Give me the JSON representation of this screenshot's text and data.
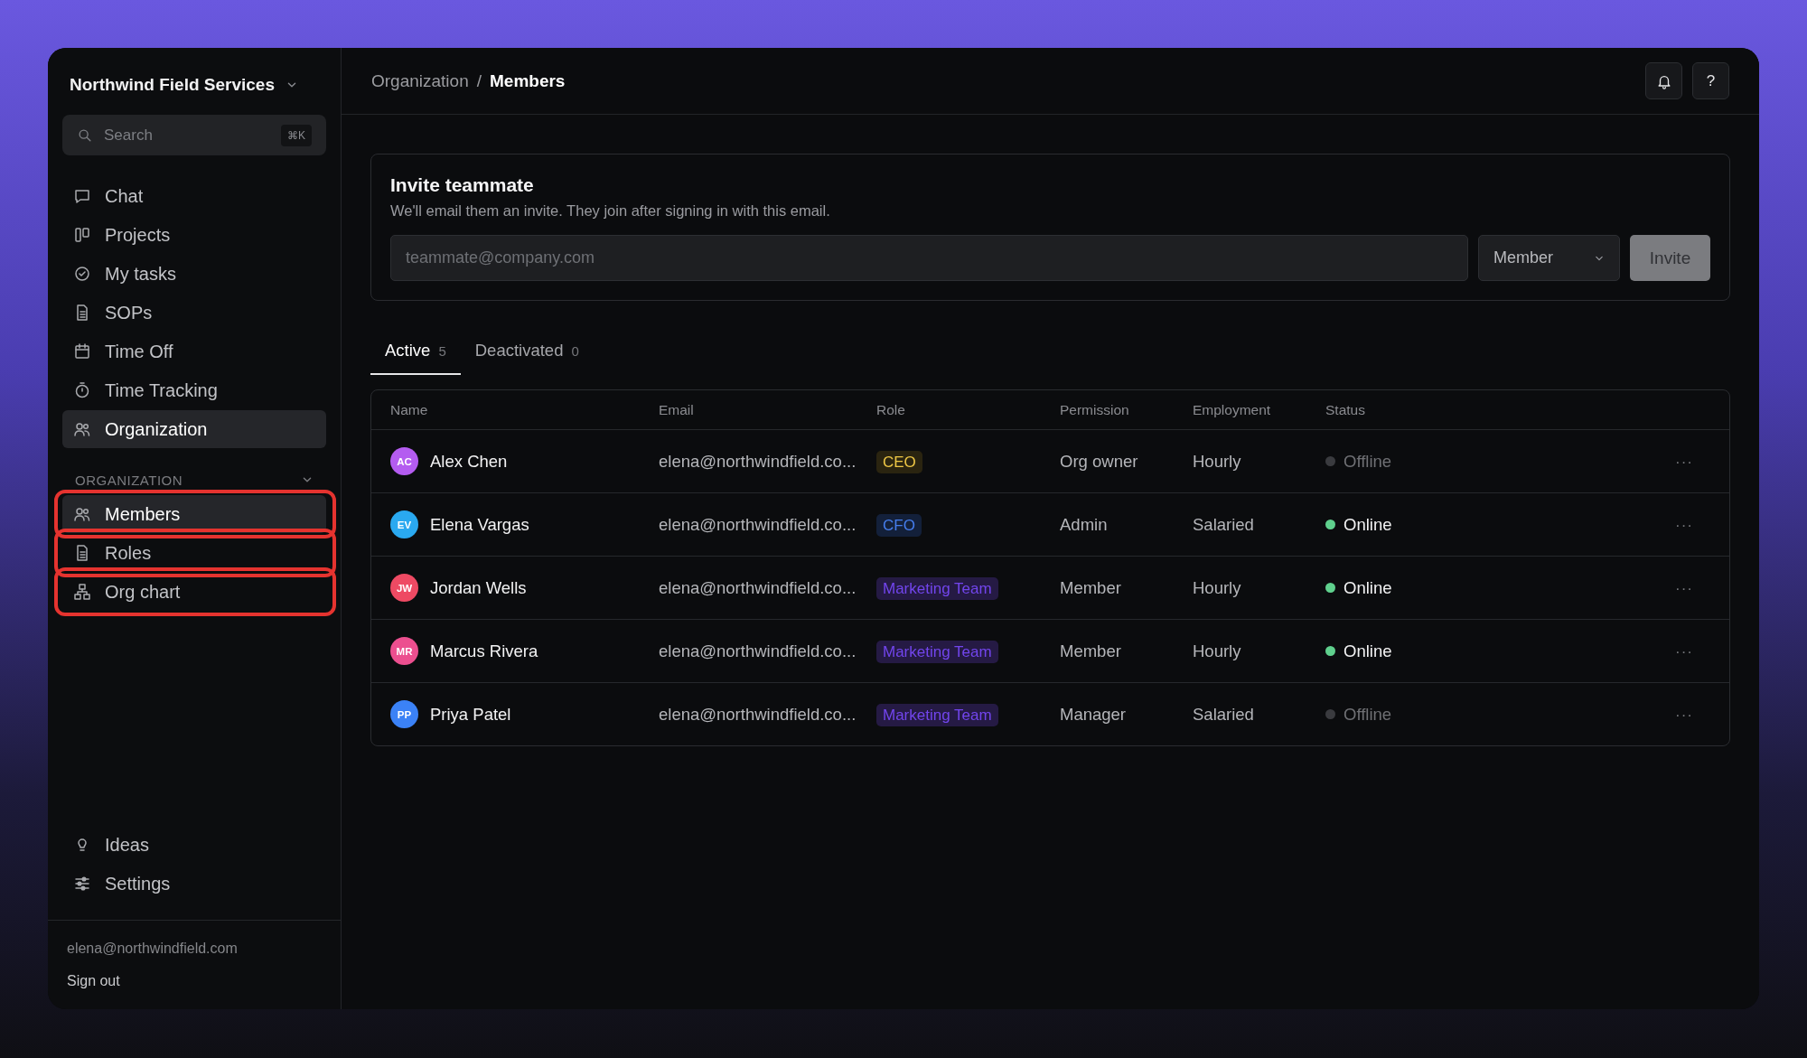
{
  "workspace": {
    "name": "Northwind Field Services"
  },
  "search": {
    "placeholder": "Search",
    "shortcut": "⌘K"
  },
  "nav": [
    {
      "label": "Chat",
      "selected": false
    },
    {
      "label": "Projects",
      "selected": false
    },
    {
      "label": "My tasks",
      "selected": false
    },
    {
      "label": "SOPs",
      "selected": false
    },
    {
      "label": "Time Off",
      "selected": false
    },
    {
      "label": "Time Tracking",
      "selected": false
    },
    {
      "label": "Organization",
      "selected": true
    }
  ],
  "section": {
    "title": "ORGANIZATION",
    "expanded": true,
    "items": [
      {
        "label": "Members",
        "selected": true,
        "highlighted": true
      },
      {
        "label": "Roles",
        "selected": false,
        "highlighted": true
      },
      {
        "label": "Org chart",
        "selected": false,
        "highlighted": true
      }
    ]
  },
  "bottom_nav": [
    {
      "label": "Ideas"
    },
    {
      "label": "Settings"
    }
  ],
  "account": {
    "email": "elena@northwindfield.com",
    "sign_out": "Sign out"
  },
  "breadcrumb": [
    {
      "kind": "link",
      "label": "Organization"
    },
    {
      "kind": "separator",
      "label": "/"
    },
    {
      "kind": "current",
      "label": "Members"
    }
  ],
  "header_buttons": [
    {
      "kind": "bell"
    },
    {
      "kind": "help",
      "label": "?"
    }
  ],
  "invite": {
    "title": "Invite teammate",
    "description": "We'll email them an invite. They join after signing in with this email.",
    "placeholder": "teammate@company.com",
    "role": "Member",
    "button": "Invite",
    "disabled": true
  },
  "tabs": [
    {
      "label": "Active",
      "count": "5",
      "selected": true
    },
    {
      "label": "Deactivated",
      "count": "0",
      "selected": false
    }
  ],
  "table": {
    "columns": [
      "Name",
      "Email",
      "Role",
      "Permission",
      "Employment",
      "Status"
    ],
    "rows": [
      {
        "avatar": {
          "initials": "AC",
          "color": "#b45cf0"
        },
        "name": "Alex Chen",
        "email": "elena@northwindfield.co...",
        "role": {
          "label": "CEO",
          "color": "#2a2410"
        },
        "permission": "Org owner",
        "employment": "Hourly",
        "status": "Offline",
        "online": false,
        "menu": "···"
      },
      {
        "avatar": {
          "initials": "EV",
          "color": "#2aa9f0"
        },
        "name": "Elena Vargas",
        "email": "elena@northwindfield.co...",
        "role": {
          "label": "CFO",
          "color": "#13203a"
        },
        "permission": "Admin",
        "employment": "Salaried",
        "status": "Online",
        "online": true,
        "menu": "···"
      },
      {
        "avatar": {
          "initials": "JW",
          "color": "#ee4a63"
        },
        "name": "Jordan Wells",
        "email": "elena@northwindfield.co...",
        "role": {
          "label": "Marketing Team",
          "color": "#251a44"
        },
        "permission": "Member",
        "employment": "Hourly",
        "status": "Online",
        "online": true,
        "menu": "···"
      },
      {
        "avatar": {
          "initials": "MR",
          "color": "#ec4f8f"
        },
        "name": "Marcus Rivera",
        "email": "elena@northwindfield.co...",
        "role": {
          "label": "Marketing Team",
          "color": "#251a44"
        },
        "permission": "Member",
        "employment": "Hourly",
        "status": "Online",
        "online": true,
        "menu": "···"
      },
      {
        "avatar": {
          "initials": "PP",
          "color": "#3b82f6"
        },
        "name": "Priya Patel",
        "email": "elena@northwindfield.co...",
        "role": {
          "label": "Marketing Team",
          "color": "#251a44"
        },
        "permission": "Manager",
        "employment": "Salaried",
        "status": "Offline",
        "online": false,
        "menu": "···"
      }
    ]
  }
}
